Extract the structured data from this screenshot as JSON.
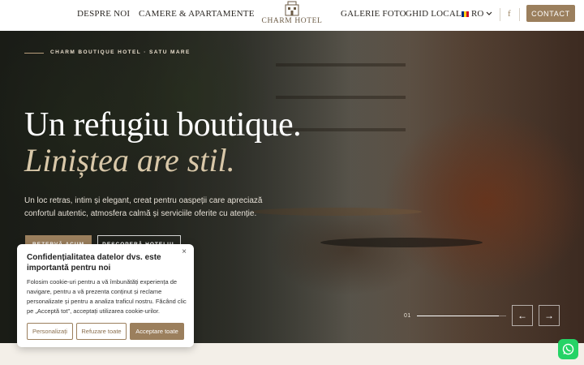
{
  "header": {
    "nav_left": [
      "DESPRE NOI",
      "CAMERE & APARTAMENTE"
    ],
    "logo_text": "CHARM HOTEL",
    "nav_right": [
      "GALERIE FOTO",
      "GHID LOCAL"
    ],
    "language": "RO",
    "contact_label": "CONTACT"
  },
  "hero": {
    "eyebrow": "CHARM BOUTIQUE HOTEL · SATU MARE",
    "title_line1": "Un refugiu boutique.",
    "title_line2": "Liniștea are stil.",
    "lead": "Un loc retras, intim și elegant, creat pentru oaspeții care apreciază confortul autentic, atmosfera calmă și serviciile oferite cu atenție.",
    "btn_primary": "REZERVĂ ACUM",
    "btn_secondary": "DESCOPERĂ HOTELUL",
    "slide_number": "01",
    "slide_progress": 0.92,
    "prev_icon": "←",
    "next_icon": "→"
  },
  "cookie": {
    "title": "Confidențialitatea datelor dvs. este importantă pentru noi",
    "body": "Folosim cookie-uri pentru a vă îmbunătăți experiența de navigare, pentru a vă prezenta conținut și reclame personalizate și pentru a analiza traficul nostru. Făcând clic pe „Acceptă tot\", acceptați utilizarea cookie-urilor.",
    "btn_customize": "Personalizați",
    "btn_reject": "Refuzare toate",
    "btn_accept": "Acceptare toate",
    "close_icon": "×"
  },
  "colors": {
    "accent": "#9b7f5d",
    "gold_text": "#d9c8a9",
    "whatsapp": "#25d366"
  }
}
